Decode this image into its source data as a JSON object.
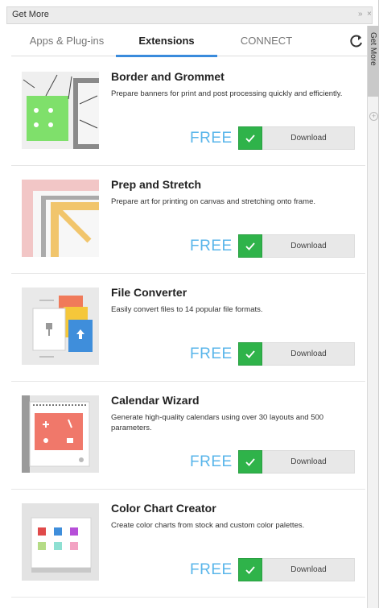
{
  "window": {
    "title": "Get More"
  },
  "tabs": [
    {
      "label": "Apps & Plug-ins",
      "active": false
    },
    {
      "label": "Extensions",
      "active": true
    },
    {
      "label": "CONNECT",
      "active": false
    }
  ],
  "side_panel": {
    "label": "Get More"
  },
  "items": [
    {
      "title": "Border and Grommet",
      "description": "Prepare banners for print and post processing quickly and efficiently.",
      "price": "FREE",
      "action": "Download",
      "icon": "border-grommet-thumbnail"
    },
    {
      "title": "Prep and Stretch",
      "description": "Prepare art for printing on canvas and stretching onto frame.",
      "price": "FREE",
      "action": "Download",
      "icon": "prep-stretch-thumbnail"
    },
    {
      "title": "File Converter",
      "description": "Easily convert files to 14 popular file formats.",
      "price": "FREE",
      "action": "Download",
      "icon": "file-converter-thumbnail"
    },
    {
      "title": "Calendar Wizard",
      "description": "Generate high-quality calendars using over 30 layouts and 500 parameters.",
      "price": "FREE",
      "action": "Download",
      "icon": "calendar-wizard-thumbnail"
    },
    {
      "title": "Color Chart Creator",
      "description": "Create color charts from stock and custom color palettes.",
      "price": "FREE",
      "action": "Download",
      "icon": "color-chart-thumbnail"
    }
  ],
  "colors": {
    "accent": "#3a8bdc",
    "price": "#58b5ea",
    "check": "#2fb34a"
  }
}
